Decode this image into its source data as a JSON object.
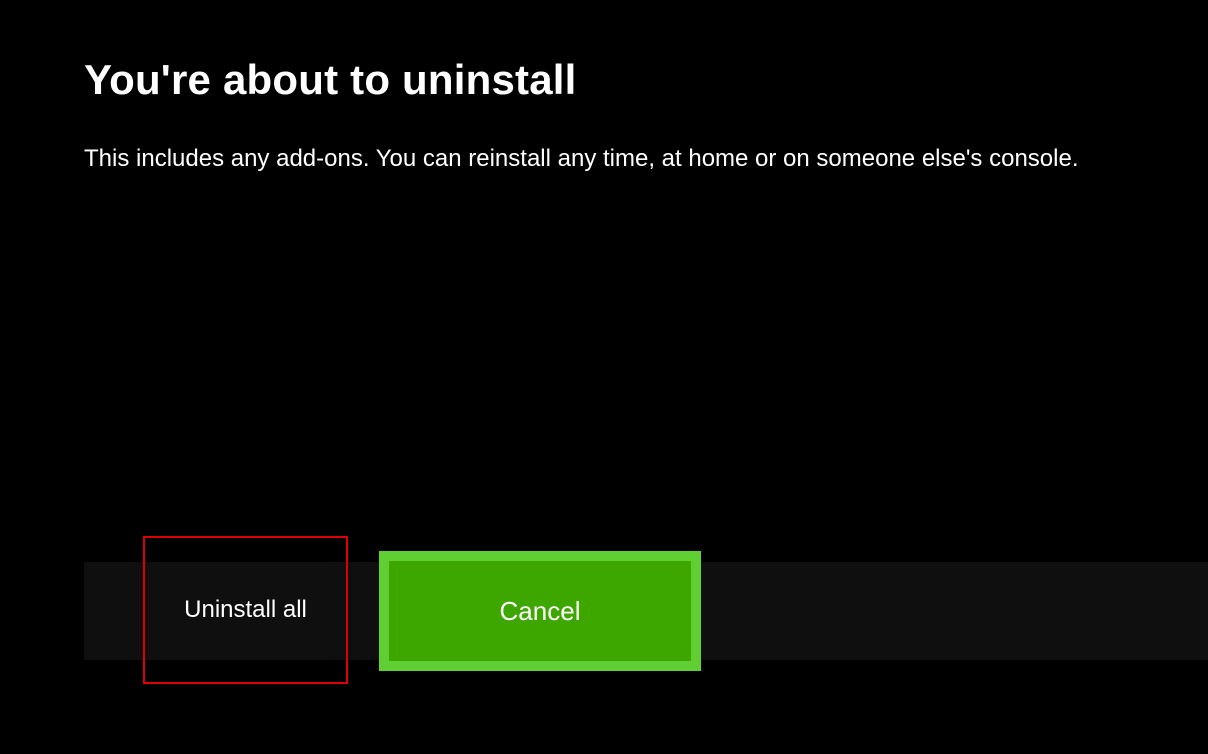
{
  "dialog": {
    "title": "You're about to uninstall",
    "subtitle": "This includes any add-ons. You can reinstall any time, at home or on someone else's console."
  },
  "buttons": {
    "uninstall_label": "Uninstall all",
    "cancel_label": "Cancel"
  }
}
